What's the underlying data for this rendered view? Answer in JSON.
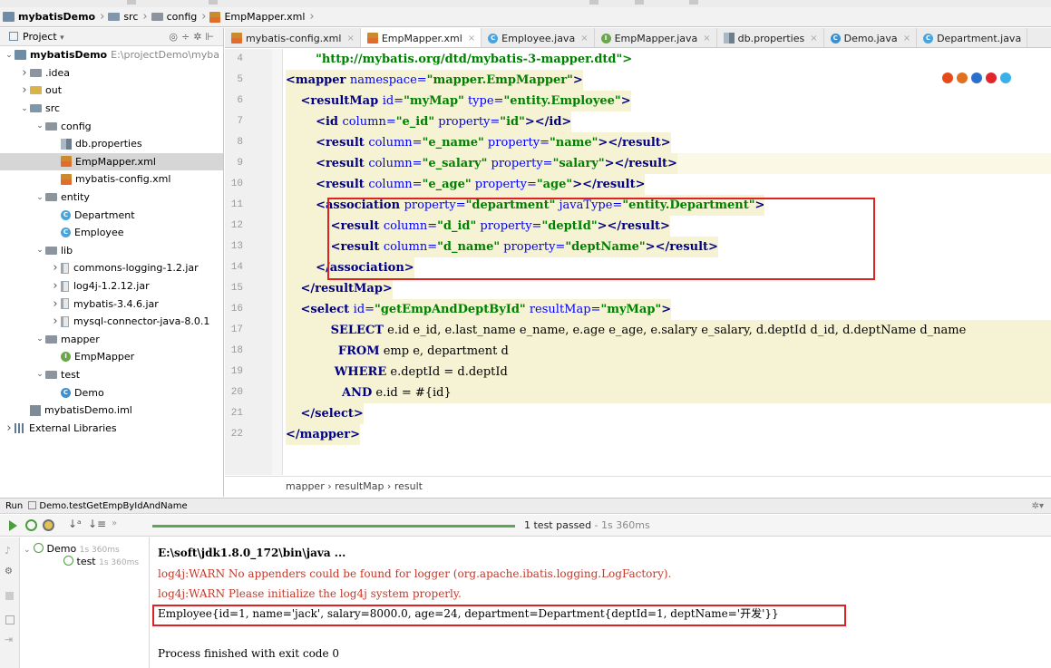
{
  "breadcrumb": {
    "project": "mybatisDemo",
    "src": "src",
    "config": "config",
    "file": "EmpMapper.xml"
  },
  "project_panel": {
    "title": "Project",
    "root_label": "mybatisDemo",
    "root_path": "E:\\projectDemo\\myba",
    "items": [
      {
        "label": "mybatisDemo"
      },
      {
        "label": ".idea"
      },
      {
        "label": "out"
      },
      {
        "label": "src"
      },
      {
        "label": "config"
      },
      {
        "label": "db.properties"
      },
      {
        "label": "EmpMapper.xml"
      },
      {
        "label": "mybatis-config.xml"
      },
      {
        "label": "entity"
      },
      {
        "label": "Department"
      },
      {
        "label": "Employee"
      },
      {
        "label": "lib"
      },
      {
        "label": "commons-logging-1.2.jar"
      },
      {
        "label": "log4j-1.2.12.jar"
      },
      {
        "label": "mybatis-3.4.6.jar"
      },
      {
        "label": "mysql-connector-java-8.0.1"
      },
      {
        "label": "mapper"
      },
      {
        "label": "EmpMapper"
      },
      {
        "label": "test"
      },
      {
        "label": "Demo"
      },
      {
        "label": "mybatisDemo.iml"
      },
      {
        "label": "External Libraries"
      }
    ]
  },
  "tabs": [
    {
      "label": "mybatis-config.xml"
    },
    {
      "label": "EmpMapper.xml"
    },
    {
      "label": "Employee.java"
    },
    {
      "label": "EmpMapper.java"
    },
    {
      "label": "db.properties"
    },
    {
      "label": "Demo.java"
    },
    {
      "label": "Department.java"
    }
  ],
  "editor": {
    "line_numbers": [
      "4",
      "5",
      "6",
      "7",
      "8",
      "9",
      "10",
      "11",
      "12",
      "13",
      "14",
      "15",
      "16",
      "17",
      "18",
      "19",
      "20",
      "21",
      "22"
    ],
    "l4": "\"http://mybatis.org/dtd/mybatis-3-mapper.dtd\">",
    "l5_tag": "<mapper ",
    "l5_attr": "namespace=",
    "l5_val": "\"mapper.EmpMapper\"",
    "l5_end": ">",
    "l6_tag": "<resultMap ",
    "l6_a1": "id=",
    "l6_v1": "\"myMap\"",
    "l6_a2": " type=",
    "l6_v2": "\"entity.Employee\"",
    "l6_end": ">",
    "l7_tag": "<id ",
    "l7_a1": "column=",
    "l7_v1": "\"e_id\"",
    "l7_a2": " property=",
    "l7_v2": "\"id\"",
    "l7_end": "></id>",
    "l8_tag": "<result ",
    "l8_a1": "column=",
    "l8_v1": "\"e_name\"",
    "l8_a2": " property=",
    "l8_v2": "\"name\"",
    "l8_end": "></result>",
    "l9_tag": "<result ",
    "l9_a1": "column=",
    "l9_v1": "\"e_salary\"",
    "l9_a2": " property=",
    "l9_v2": "\"salary\"",
    "l9_end": "></result>",
    "l10_tag": "<result ",
    "l10_a1": "column=",
    "l10_v1": "\"e_age\"",
    "l10_a2": " property=",
    "l10_v2": "\"age\"",
    "l10_end": "></result>",
    "l11_tag": "<association ",
    "l11_a1": "property=",
    "l11_v1": "\"department\"",
    "l11_a2": " javaType=",
    "l11_v2": "\"entity.Department\"",
    "l11_end": ">",
    "l12_tag": "<result ",
    "l12_a1": "column=",
    "l12_v1": "\"d_id\"",
    "l12_a2": " property=",
    "l12_v2": "\"deptId\"",
    "l12_end": "></result>",
    "l13_tag": "<result ",
    "l13_a1": "column=",
    "l13_v1": "\"d_name\"",
    "l13_a2": " property=",
    "l13_v2": "\"deptName\"",
    "l13_end": "></result>",
    "l14": "</association>",
    "l15": "</resultMap>",
    "l16_tag": "<select ",
    "l16_a1": "id=",
    "l16_v1": "\"getEmpAndDeptById\"",
    "l16_a2": " resultMap=",
    "l16_v2": "\"myMap\"",
    "l16_end": ">",
    "l17_kw": "SELECT",
    "l17_rest": " e.id e_id, e.last_name e_name, e.age e_age, e.salary e_salary, d.deptId d_id, d.deptName d_name",
    "l18_kw": "FROM",
    "l18_rest": " emp e, department d",
    "l19_kw": "WHERE",
    "l19_rest": " e.deptId = d.deptId",
    "l20_kw": "AND",
    "l20_rest": " e.id = #{id}",
    "l21": "</select>",
    "l22": "</mapper>"
  },
  "editor_breadcrumb": "mapper  ›  resultMap  ›  result",
  "run": {
    "title": "Run",
    "config": "Demo.testGetEmpByIdAndName",
    "status": "1 test passed",
    "duration": " - 1s 360ms",
    "tree_root": "Demo",
    "tree_root_time": "1s 360ms",
    "tree_child": "test",
    "tree_child_time": "1s 360ms",
    "console": [
      "E:\\soft\\jdk1.8.0_172\\bin\\java ...",
      "log4j:WARN No appenders could be found for logger (org.apache.ibatis.logging.LogFactory).",
      "log4j:WARN Please initialize the log4j system properly.",
      "Employee{id=1, name='jack', salary=8000.0, age=24, department=Department{deptId=1, deptName='开发'}}",
      "",
      "Process finished with exit code 0"
    ]
  },
  "colors": {
    "highlight_box": "#e02121",
    "tag": "#000080",
    "attr_value": "#008000",
    "warn": "#c23a2b"
  }
}
